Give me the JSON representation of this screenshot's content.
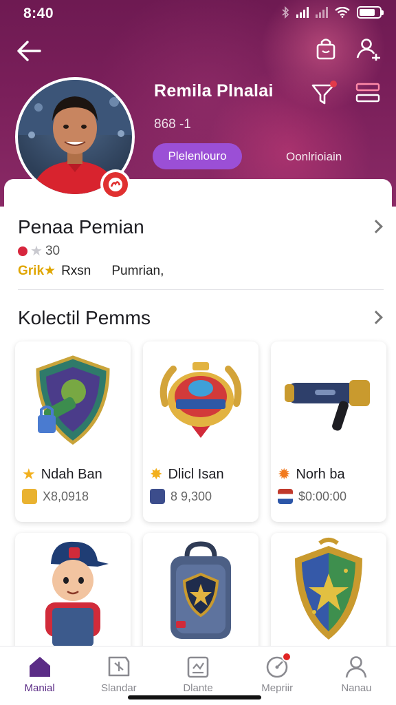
{
  "status_bar": {
    "time": "8:40"
  },
  "header": {
    "back_icon": "arrow-left-icon",
    "bag_icon": "shopping-bag-icon",
    "user_icon": "user-settings-icon",
    "filter_icon": "filter-icon",
    "menu_icon": "menu-icon",
    "profile": {
      "name": "Remila Plnalai",
      "id": "868 -1",
      "primary_button": "Plelenlouro",
      "secondary_link": "Oonlrioiain"
    }
  },
  "summary": {
    "title": "Penaa Pemian",
    "rating": "30",
    "meta_gold": "Grik",
    "meta_1": "Rxsn",
    "meta_2": "Pumrian,"
  },
  "collection": {
    "title": "Kolectil Pemms",
    "items": [
      {
        "name": "Ndah Ban",
        "price": "X8,0918",
        "icon": "shield-emblem"
      },
      {
        "name": "Dlicl Isan",
        "price": "8 9,300",
        "icon": "medal-badge"
      },
      {
        "name": "Norh ba",
        "price": "$0:00:00",
        "icon": "cannon"
      },
      {
        "name": "",
        "price": "",
        "icon": "player-figure"
      },
      {
        "name": "",
        "price": "",
        "icon": "backpack"
      },
      {
        "name": "",
        "price": "",
        "icon": "star-shield"
      }
    ]
  },
  "bottom_nav": [
    {
      "label": "Manial",
      "icon": "home-icon",
      "active": true
    },
    {
      "label": "Slandar",
      "icon": "map-icon",
      "active": false
    },
    {
      "label": "Dlante",
      "icon": "clipboard-icon",
      "active": false
    },
    {
      "label": "Mepriir",
      "icon": "gauge-icon",
      "active": false,
      "badge": true
    },
    {
      "label": "Nanau",
      "icon": "person-icon",
      "active": false
    }
  ],
  "colors": {
    "header": "#7a1f5a",
    "accent": "#9b4fd6",
    "nav_active": "#5b2c86",
    "gold": "#e0a600"
  }
}
